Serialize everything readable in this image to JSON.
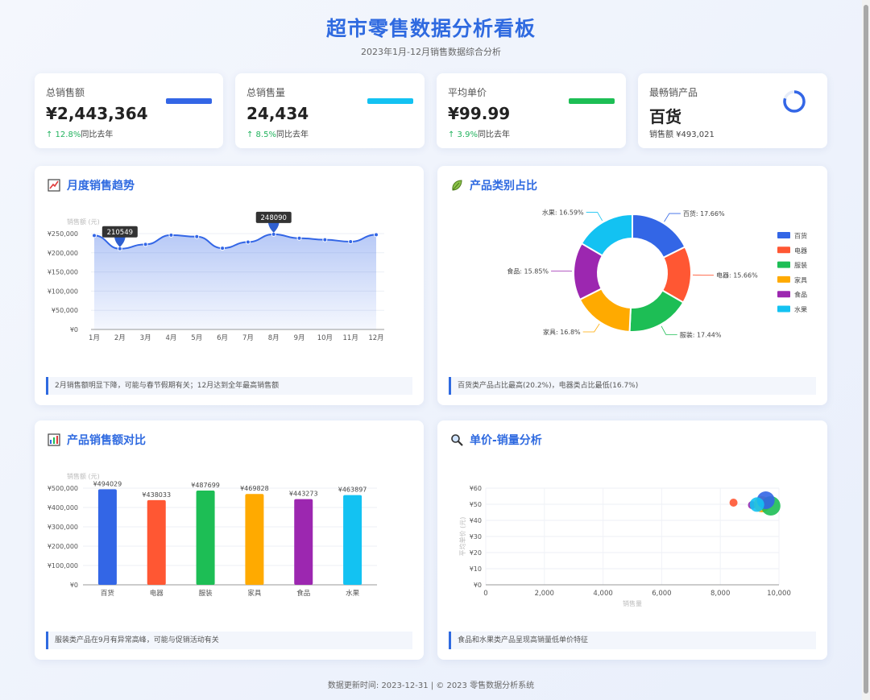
{
  "header": {
    "title": "超市零售数据分析看板",
    "subtitle": "2023年1月-12月销售数据综合分析"
  },
  "kpis": [
    {
      "label": "总销售额",
      "value": "¥2,443,364",
      "change": "↑ 12.8%",
      "suffix": "同比去年",
      "bar_color": "#3366e6"
    },
    {
      "label": "总销售量",
      "value": "24,434",
      "change": "↑ 8.5%",
      "suffix": "同比去年",
      "bar_color": "#13c2f2"
    },
    {
      "label": "平均单价",
      "value": "¥99.99",
      "change": "↑ 3.9%",
      "suffix": "同比去年",
      "bar_color": "#1dbe55"
    },
    {
      "label": "最畅销产品",
      "value": "百货",
      "sub": "销售额 ¥493,021",
      "ring_color": "#3366e6"
    }
  ],
  "panels": {
    "trend": {
      "title": "月度销售趋势",
      "icon": "chart-line-icon",
      "note": "2月销售额明显下降，可能与春节假期有关；12月达到全年最高销售额"
    },
    "category": {
      "title": "产品类别占比",
      "icon": "leaf-icon",
      "note": "百货类产品占比最高(20.2%)，电器类占比最低(16.7%)"
    },
    "compare": {
      "title": "产品销售额对比",
      "icon": "bar-chart-icon",
      "note": "服装类产品在9月有异常高峰，可能与促销活动有关"
    },
    "scatter": {
      "title": "单价-销量分析",
      "icon": "magnifier-icon",
      "note": "食品和水果类产品呈现高销量低单价特征"
    }
  },
  "chart_data": [
    {
      "type": "area",
      "name": "trend",
      "ylabel": "销售额 (元)",
      "categories": [
        "1月",
        "2月",
        "3月",
        "4月",
        "5月",
        "6月",
        "7月",
        "8月",
        "9月",
        "10月",
        "11月",
        "12月"
      ],
      "values": [
        245000,
        210549,
        222000,
        246000,
        242000,
        212000,
        228000,
        248090,
        238000,
        234000,
        229000,
        247000
      ],
      "ylim": [
        0,
        250000
      ],
      "yticks": [
        "¥0",
        "¥50,000",
        "¥100,000",
        "¥150,000",
        "¥200,000",
        "¥250,000"
      ],
      "markers": [
        {
          "category": "2月",
          "label": "210549"
        },
        {
          "category": "8月",
          "label": "248090"
        }
      ]
    },
    {
      "type": "pie",
      "name": "category",
      "legend_position": "right",
      "slices": [
        {
          "name": "百货",
          "value": 17.66,
          "label": "百货: 17.66%",
          "color": "#3366e6"
        },
        {
          "name": "电器",
          "value": 15.66,
          "label": "电器: 15.66%",
          "color": "#ff5733"
        },
        {
          "name": "服装",
          "value": 17.44,
          "label": "服装: 17.44%",
          "color": "#1dbe55"
        },
        {
          "name": "家具",
          "value": 16.8,
          "label": "家具: 16.8%",
          "color": "#ffaa00"
        },
        {
          "name": "食品",
          "value": 15.85,
          "label": "食品: 15.85%",
          "color": "#9c27b0"
        },
        {
          "name": "水果",
          "value": 16.59,
          "label": "水果: 16.59%",
          "color": "#13c2f2"
        }
      ]
    },
    {
      "type": "bar",
      "name": "compare",
      "ylabel": "销售额 (元)",
      "categories": [
        "百货",
        "电器",
        "服装",
        "家具",
        "食品",
        "水果"
      ],
      "values": [
        494029,
        438033,
        487699,
        469828,
        443273,
        463897
      ],
      "labels": [
        "¥494029",
        "¥438033",
        "¥487699",
        "¥469828",
        "¥443273",
        "¥463897"
      ],
      "colors": [
        "#3366e6",
        "#ff5733",
        "#1dbe55",
        "#ffaa00",
        "#9c27b0",
        "#13c2f2"
      ],
      "ylim": [
        0,
        500000
      ],
      "yticks": [
        "¥0",
        "¥100,000",
        "¥200,000",
        "¥300,000",
        "¥400,000",
        "¥500,000"
      ]
    },
    {
      "type": "scatter",
      "name": "scatter",
      "xlabel": "销售量",
      "ylabel": "平均单价 (元)",
      "xlim": [
        0,
        10000
      ],
      "ylim": [
        0,
        60
      ],
      "xticks": [
        "0",
        "2,000",
        "4,000",
        "6,000",
        "8,000",
        "10,000"
      ],
      "yticks": [
        "¥0",
        "¥10",
        "¥20",
        "¥30",
        "¥40",
        "¥50",
        "¥60"
      ],
      "points": [
        {
          "name": "电器",
          "x": 8450,
          "y": 51,
          "r": 5,
          "color": "#ff5733"
        },
        {
          "name": "食品",
          "x": 9080,
          "y": 49.5,
          "r": 5,
          "color": "#9c27b0"
        },
        {
          "name": "家具",
          "x": 9420,
          "y": 50,
          "r": 10,
          "color": "#ffaa00"
        },
        {
          "name": "服装",
          "x": 9720,
          "y": 49,
          "r": 12,
          "color": "#1dbe55"
        },
        {
          "name": "百货",
          "x": 9550,
          "y": 52.5,
          "r": 11,
          "color": "#3366e6"
        },
        {
          "name": "水果",
          "x": 9250,
          "y": 49.8,
          "r": 9,
          "color": "#13c2f2"
        }
      ]
    }
  ],
  "footer": "数据更新时间: 2023-12-31 | © 2023 零售数据分析系统"
}
